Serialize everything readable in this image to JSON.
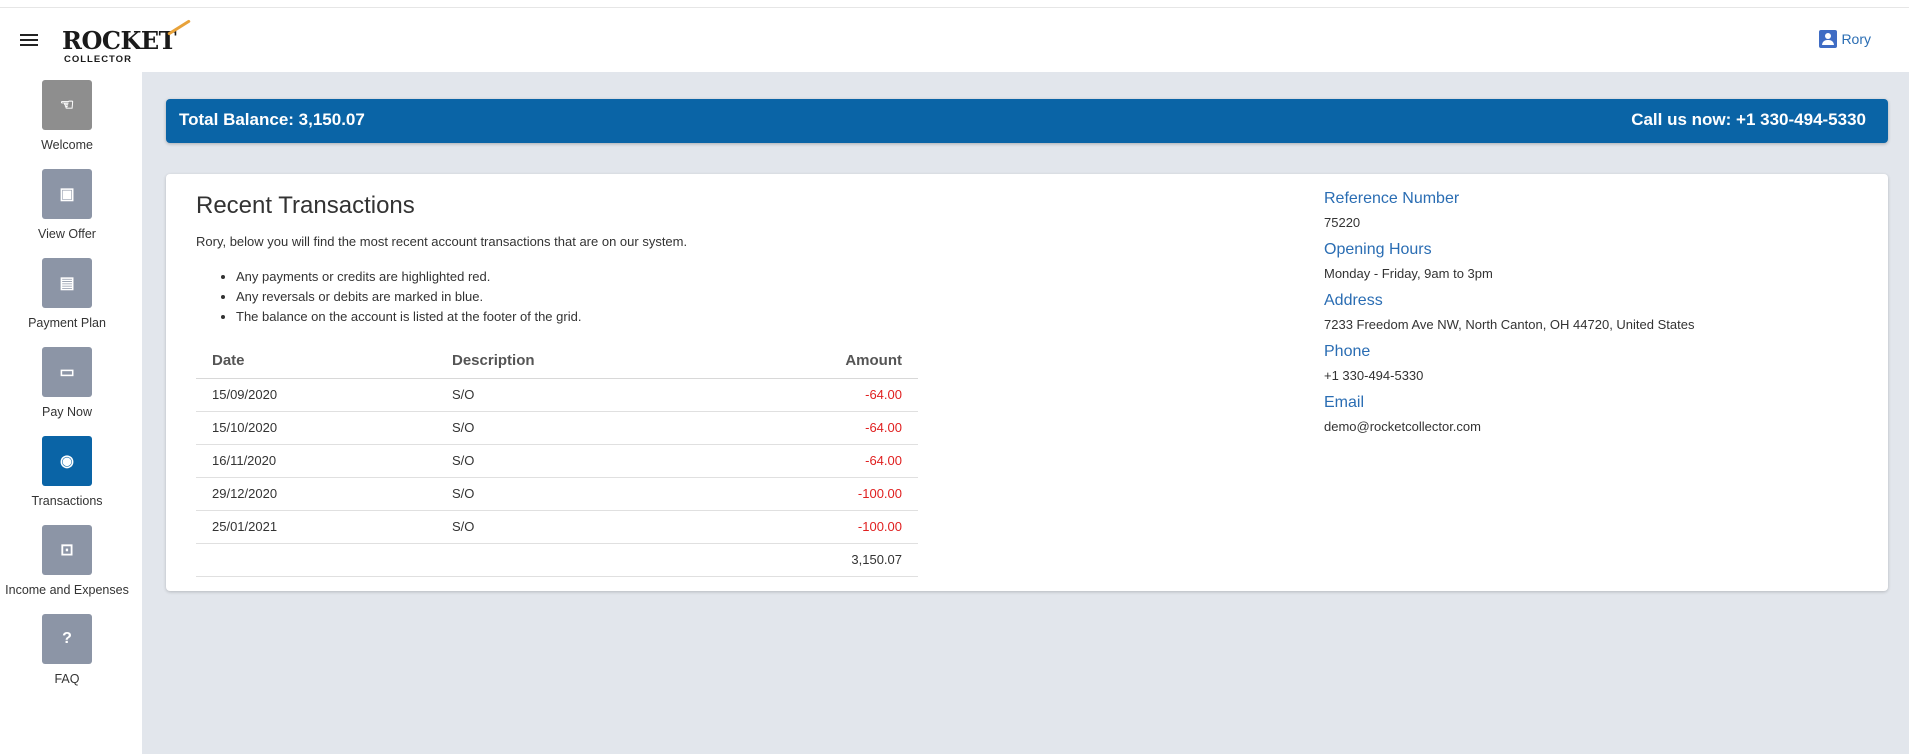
{
  "header": {
    "logo_main": "ROCKET",
    "logo_sub": "COLLECTOR",
    "user_name": "Rory"
  },
  "sidebar": {
    "items": [
      {
        "label": "Welcome",
        "icon": "handshake-icon",
        "glyph": "☜"
      },
      {
        "label": "View Offer",
        "icon": "briefcase-icon",
        "glyph": "▣"
      },
      {
        "label": "Payment Plan",
        "icon": "card-icon",
        "glyph": "▤"
      },
      {
        "label": "Pay Now",
        "icon": "payment-card-icon",
        "glyph": "▭"
      },
      {
        "label": "Transactions",
        "icon": "person-circle-icon",
        "glyph": "◉"
      },
      {
        "label": "Income and Expenses",
        "icon": "money-icon",
        "glyph": "⊡"
      },
      {
        "label": "FAQ",
        "icon": "help-icon",
        "glyph": "?"
      }
    ],
    "active": "Transactions"
  },
  "balance_bar": {
    "total_label": "Total Balance: 3,150.07",
    "call_label": "Call us now: +1 330-494-5330"
  },
  "transactions": {
    "title": "Recent Transactions",
    "intro": "Rory, below you will find the most recent account transactions that are on our system.",
    "bullets": [
      "Any payments or credits are highlighted red.",
      "Any reversals or debits are marked in blue.",
      "The balance on the account is listed at the footer of the grid."
    ],
    "columns": {
      "date": "Date",
      "description": "Description",
      "amount": "Amount"
    },
    "rows": [
      {
        "date": "15/09/2020",
        "description": "S/O",
        "amount": "-64.00"
      },
      {
        "date": "15/10/2020",
        "description": "S/O",
        "amount": "-64.00"
      },
      {
        "date": "16/11/2020",
        "description": "S/O",
        "amount": "-64.00"
      },
      {
        "date": "29/12/2020",
        "description": "S/O",
        "amount": "-100.00"
      },
      {
        "date": "25/01/2021",
        "description": "S/O",
        "amount": "-100.00"
      }
    ],
    "footer_total": "3,150.07"
  },
  "info": {
    "reference_label": "Reference Number",
    "reference_value": "75220",
    "hours_label": "Opening Hours",
    "hours_value": "Monday - Friday, 9am to 3pm",
    "address_label": "Address",
    "address_value": "7233 Freedom Ave NW, North Canton, OH 44720, United States",
    "phone_label": "Phone",
    "phone_value": "+1 330-494-5330",
    "email_label": "Email",
    "email_value": "demo@rocketcollector.com"
  },
  "colors": {
    "brand_blue": "#0a64a6",
    "credit_red": "#e02020",
    "link_blue": "#2a6db3",
    "page_bg": "#e2e6ec"
  }
}
